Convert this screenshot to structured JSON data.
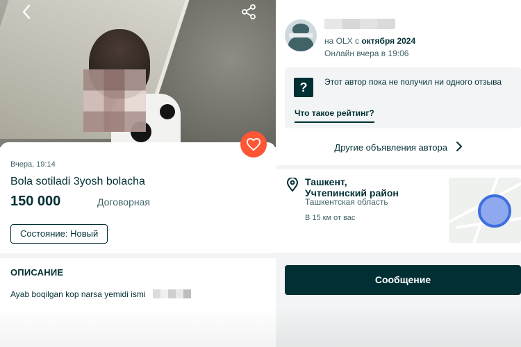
{
  "colors": {
    "brand_dark": "#002f34",
    "favorite": "#ff5636",
    "secondary_text": "#406367",
    "map_circle": "#3f6fe0"
  },
  "listing": {
    "posted": "Вчера, 19:14",
    "title": "Bola sotiladi 3yosh bolacha",
    "price": "150 000",
    "negotiable": "Договорная",
    "condition": "Состояние: Новый",
    "description_heading": "ОПИСАНИЕ",
    "description_text": "Ayab boqilgan kop narsa yemidi ismi"
  },
  "seller": {
    "since_prefix": "на OLX с ",
    "since_date": "октября 2024",
    "online": "Онлайн вчера в 19:06",
    "no_reviews": "Этот автор пока не получил ни одного отзыва",
    "rating_link": "Что такое рейтинг?",
    "other_ads": "Другие объявления автора"
  },
  "location": {
    "city": "Ташкент,",
    "district": "Учтепинский район",
    "region": "Ташкентская область",
    "distance": "В 15 км от вас"
  },
  "actions": {
    "message": "Сообщение"
  },
  "icons": {
    "back": "chevron-left",
    "share": "share",
    "favorite": "heart",
    "help": "question",
    "location": "map-pin",
    "chevron": "chevron-right"
  }
}
